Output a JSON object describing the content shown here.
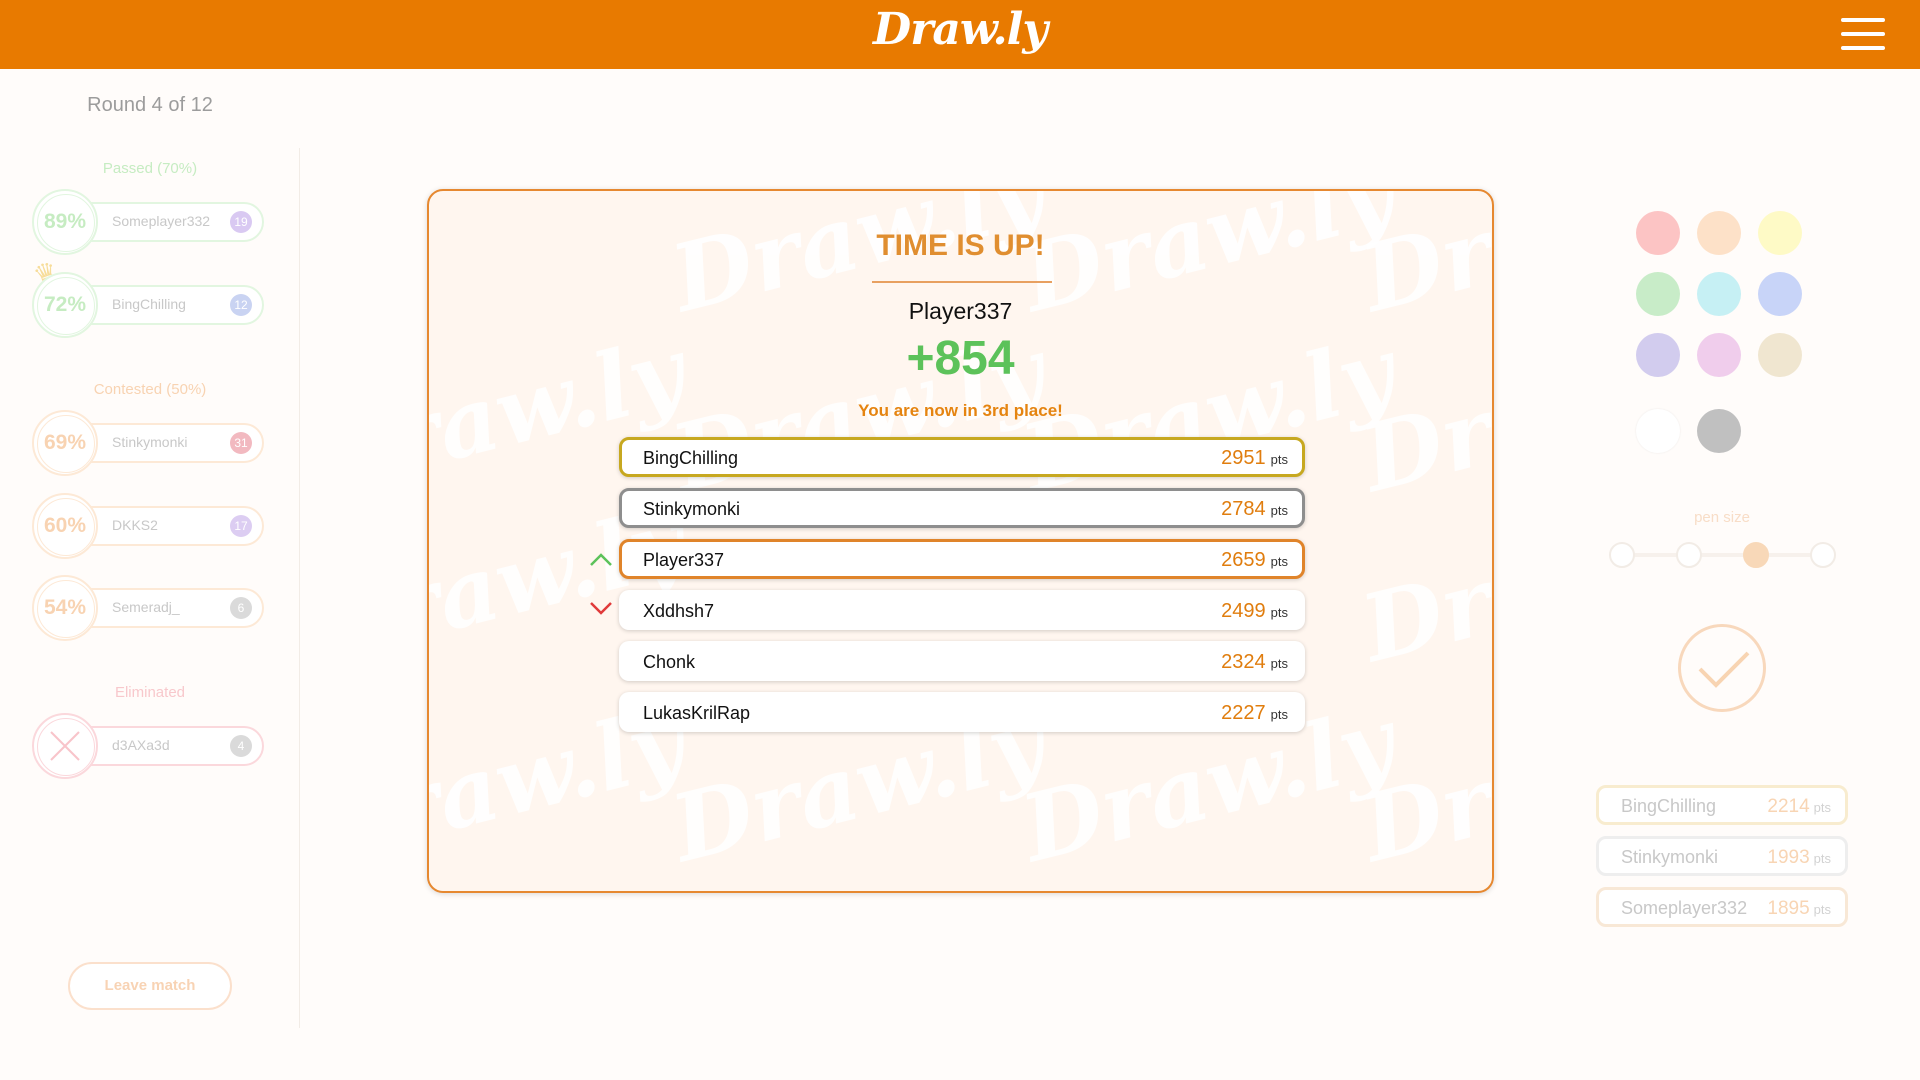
{
  "header": {
    "logo_text": "Draw.ly",
    "menu_icon": "hamburger-menu-icon",
    "background_color": "#e87a00"
  },
  "round": {
    "label": "Round 4 of 12"
  },
  "sections": {
    "passed": "Passed (70%)",
    "contested": "Contested (50%)",
    "eliminated": "Eliminated"
  },
  "players": {
    "passed": [
      {
        "percent": "89%",
        "name": "Someplayer332",
        "badge": "19",
        "badge_color": "#d9c9f2"
      },
      {
        "percent": "72%",
        "name": "BingChilling",
        "badge": "12",
        "badge_color": "#c9d3f2"
      }
    ],
    "contested": [
      {
        "percent": "69%",
        "name": "Stinkymonki",
        "badge": "31",
        "badge_color": "#f2b9c0"
      },
      {
        "percent": "60%",
        "name": "DKKS2",
        "badge": "17",
        "badge_color": "#dccdf2"
      },
      {
        "percent": "54%",
        "name": "Semeradj_",
        "badge": "6",
        "badge_color": "#dadada"
      }
    ],
    "eliminated": [
      {
        "name": "d3AXa3d",
        "badge": "4",
        "badge_color": "#dadada"
      }
    ]
  },
  "leave_button": "Leave match",
  "palette": {
    "colors": [
      "#fcc4c4",
      "#fde1c8",
      "#fefac6",
      "#c8ecc8",
      "#c6f0f4",
      "#c8d4f8",
      "#d2ccee",
      "#f0cdec",
      "#f0e6d0",
      "#ffffff",
      "#c0c0c0"
    ]
  },
  "pen_size": {
    "label": "pen size",
    "options": 4,
    "selected_index": 2
  },
  "confirm_icon": "checkmark-icon",
  "mini_leaderboard": [
    {
      "name": "BingChilling",
      "score": "2214",
      "unit": "pts",
      "border": "#f8eccf"
    },
    {
      "name": "Stinkymonki",
      "score": "1993",
      "unit": "pts",
      "border": "#eeeeee"
    },
    {
      "name": "Someplayer332",
      "score": "1895",
      "unit": "pts",
      "border": "#f8e8d6"
    }
  ],
  "modal": {
    "title": "TIME IS UP!",
    "player": "Player337",
    "delta": "+854",
    "place_text": "You are now in 3rd place!",
    "watermark": "Draw.ly",
    "unit": "pts",
    "leaderboard": [
      {
        "name": "BingChilling",
        "score": "2951",
        "style": "gold",
        "change": ""
      },
      {
        "name": "Stinkymonki",
        "score": "2784",
        "style": "silver",
        "change": ""
      },
      {
        "name": "Player337",
        "score": "2659",
        "style": "me",
        "change": "up"
      },
      {
        "name": "Xddhsh7",
        "score": "2499",
        "style": "",
        "change": "down"
      },
      {
        "name": "Chonk",
        "score": "2324",
        "style": "",
        "change": ""
      },
      {
        "name": "LukasKrilRap",
        "score": "2227",
        "style": "",
        "change": ""
      }
    ]
  }
}
